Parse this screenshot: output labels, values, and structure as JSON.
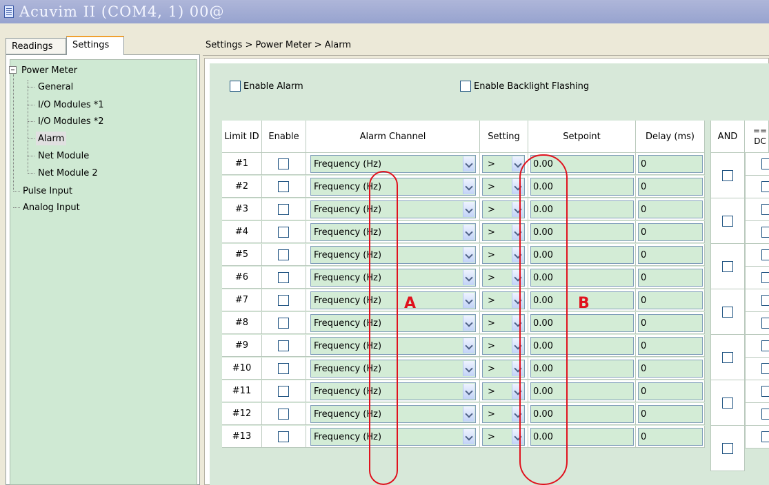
{
  "window": {
    "title": "Acuvim II (COM4, 1) 00@"
  },
  "tabs": [
    {
      "label": "Readings"
    },
    {
      "label": "Settings"
    }
  ],
  "tree": {
    "root": "Power Meter",
    "children": [
      "General",
      "I/O Modules *1",
      "I/O Modules *2",
      "Alarm",
      "Net Module",
      "Net Module 2"
    ],
    "others": [
      "Pulse Input",
      "Analog Input"
    ],
    "selected": "Alarm"
  },
  "breadcrumb": "Settings > Power Meter > Alarm",
  "options": {
    "enable_alarm": "Enable Alarm",
    "enable_backlight": "Enable Backlight Flashing"
  },
  "table": {
    "headers": {
      "limit_id": "Limit ID",
      "enable": "Enable",
      "channel": "Alarm Channel",
      "setting": "Setting",
      "setpoint": "Setpoint",
      "delay": "Delay (ms)",
      "and": "AND",
      "next": "==\nDC"
    },
    "rows": [
      {
        "id": "#1",
        "channel": "Frequency (Hz)",
        "setting": ">",
        "setpoint": "0.00",
        "delay": "0"
      },
      {
        "id": "#2",
        "channel": "Frequency (Hz)",
        "setting": ">",
        "setpoint": "0.00",
        "delay": "0"
      },
      {
        "id": "#3",
        "channel": "Frequency (Hz)",
        "setting": ">",
        "setpoint": "0.00",
        "delay": "0"
      },
      {
        "id": "#4",
        "channel": "Frequency (Hz)",
        "setting": ">",
        "setpoint": "0.00",
        "delay": "0"
      },
      {
        "id": "#5",
        "channel": "Frequency (Hz)",
        "setting": ">",
        "setpoint": "0.00",
        "delay": "0"
      },
      {
        "id": "#6",
        "channel": "Frequency (Hz)",
        "setting": ">",
        "setpoint": "0.00",
        "delay": "0"
      },
      {
        "id": "#7",
        "channel": "Frequency (Hz)",
        "setting": ">",
        "setpoint": "0.00",
        "delay": "0"
      },
      {
        "id": "#8",
        "channel": "Frequency (Hz)",
        "setting": ">",
        "setpoint": "0.00",
        "delay": "0"
      },
      {
        "id": "#9",
        "channel": "Frequency (Hz)",
        "setting": ">",
        "setpoint": "0.00",
        "delay": "0"
      },
      {
        "id": "#10",
        "channel": "Frequency (Hz)",
        "setting": ">",
        "setpoint": "0.00",
        "delay": "0"
      },
      {
        "id": "#11",
        "channel": "Frequency (Hz)",
        "setting": ">",
        "setpoint": "0.00",
        "delay": "0"
      },
      {
        "id": "#12",
        "channel": "Frequency (Hz)",
        "setting": ">",
        "setpoint": "0.00",
        "delay": "0"
      },
      {
        "id": "#13",
        "channel": "Frequency (Hz)",
        "setting": ">",
        "setpoint": "0.00",
        "delay": "0"
      }
    ]
  },
  "annotations": {
    "a": "A",
    "b": "B"
  },
  "colors": {
    "field_bg": "#d3ecd6",
    "annotation": "#e0121e",
    "titlebar": "#97a3cf"
  }
}
